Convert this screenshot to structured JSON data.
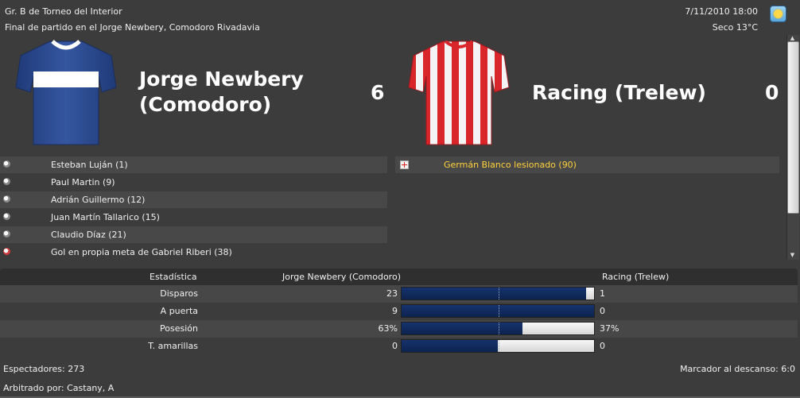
{
  "header": {
    "competition": "Gr. B de Torneo del Interior",
    "match_status": "Final de partido en el Jorge Newbery, Comodoro Rivadavia",
    "datetime": "7/11/2010 18:00",
    "weather": "Seco 13°C",
    "weather_icon": "sun-icon"
  },
  "home": {
    "name_line1": "Jorge Newbery",
    "name_line2": "(Comodoro)",
    "score": "6",
    "kit_icon": "blue-white-band-shirt",
    "colors": {
      "primary": "#2b4a8c",
      "band": "#ffffff"
    }
  },
  "away": {
    "name": "Racing (Trelew)",
    "score": "0",
    "kit_icon": "red-white-striped-shirt",
    "colors": {
      "primary": "#d8262b",
      "stripe": "#ffffff"
    }
  },
  "home_events": [
    {
      "icon": "goal-icon",
      "text": "Esteban Luján (1)"
    },
    {
      "icon": "goal-icon",
      "text": "Paul Martin (9)"
    },
    {
      "icon": "goal-icon",
      "text": "Adrián Guillermo (12)"
    },
    {
      "icon": "goal-icon",
      "text": "Juan Martín Tallarico (15)"
    },
    {
      "icon": "goal-icon",
      "text": "Claudio Díaz (21)"
    },
    {
      "icon": "own-goal-icon",
      "text": "Gol en propia meta de Gabriel Riberi (38)"
    }
  ],
  "away_events": [
    {
      "icon": "injury-icon",
      "text": "Germán Blanco lesionado (90)",
      "color": "#ffd23c"
    }
  ],
  "stats": {
    "header": {
      "label": "Estadística",
      "home": "Jorge Newbery (Comodoro)",
      "away": "Racing (Trelew)"
    },
    "rows": [
      {
        "label": "Disparos",
        "home": "23",
        "away": "1",
        "home_fraction": 0.958
      },
      {
        "label": "A puerta",
        "home": "9",
        "away": "0",
        "home_fraction": 1.0
      },
      {
        "label": "Posesión",
        "home": "63%",
        "away": "37%",
        "home_fraction": 0.63
      },
      {
        "label": "T. amarillas",
        "home": "0",
        "away": "0",
        "home_fraction": 0.5
      }
    ]
  },
  "footer": {
    "attendance": "Espectadores: 273",
    "halftime": "Marcador al descanso: 6:0",
    "referee": "Arbitrado por: Castany, A"
  }
}
